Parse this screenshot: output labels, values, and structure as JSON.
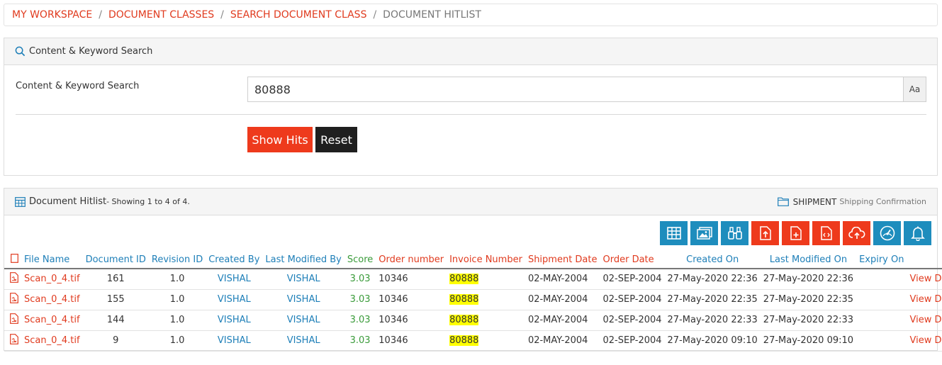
{
  "breadcrumb": {
    "items": [
      "MY WORKSPACE",
      "DOCUMENT CLASSES",
      "SEARCH DOCUMENT CLASS",
      "DOCUMENT HITLIST"
    ],
    "separator": "/"
  },
  "search": {
    "panel_title": "Content & Keyword Search",
    "field_label": "Content & Keyword Search",
    "value": "80888",
    "case_button": "Aa",
    "show_hits_label": "Show Hits",
    "reset_label": "Reset"
  },
  "hitlist": {
    "title": "Document Hitlist",
    "showing": " - Showing 1 to 4 of 4.",
    "doc_type": "SHIPMENT",
    "doc_sub": "Shipping Confirmation",
    "toolbar_icons": [
      {
        "name": "table-view-icon",
        "color": "blue"
      },
      {
        "name": "image-view-icon",
        "color": "blue"
      },
      {
        "name": "binoculars-icon",
        "color": "blue"
      },
      {
        "name": "file-upload-icon",
        "color": "red"
      },
      {
        "name": "file-add-icon",
        "color": "red"
      },
      {
        "name": "file-code-icon",
        "color": "red"
      },
      {
        "name": "cloud-upload-icon",
        "color": "red"
      },
      {
        "name": "dashboard-icon",
        "color": "blue"
      },
      {
        "name": "bell-icon",
        "color": "blue"
      }
    ],
    "columns": [
      "File Name",
      "Document ID",
      "Revision ID",
      "Created By",
      "Last Modified By",
      "Score",
      "Order number",
      "Invoice Number",
      "Shipment Date",
      "Order Date",
      "Created On",
      "Last Modified On",
      "Expiry On"
    ],
    "rows": [
      {
        "file": "Scan_0_4.tif",
        "doc_id": "161",
        "rev": "1.0",
        "created_by": "VISHAL",
        "modified_by": "VISHAL",
        "score": "3.03",
        "order_no": "10346",
        "invoice": "80888",
        "ship_date": "02-MAY-2004",
        "order_date": "02-SEP-2004",
        "created_on": "27-May-2020 22:36",
        "modified_on": "27-May-2020 22:36",
        "expiry": "",
        "action": "View Document"
      },
      {
        "file": "Scan_0_4.tif",
        "doc_id": "155",
        "rev": "1.0",
        "created_by": "VISHAL",
        "modified_by": "VISHAL",
        "score": "3.03",
        "order_no": "10346",
        "invoice": "80888",
        "ship_date": "02-MAY-2004",
        "order_date": "02-SEP-2004",
        "created_on": "27-May-2020 22:35",
        "modified_on": "27-May-2020 22:35",
        "expiry": "",
        "action": "View Document"
      },
      {
        "file": "Scan_0_4.tif",
        "doc_id": "144",
        "rev": "1.0",
        "created_by": "VISHAL",
        "modified_by": "VISHAL",
        "score": "3.03",
        "order_no": "10346",
        "invoice": "80888",
        "ship_date": "02-MAY-2004",
        "order_date": "02-SEP-2004",
        "created_on": "27-May-2020 22:33",
        "modified_on": "27-May-2020 22:33",
        "expiry": "",
        "action": "View Document"
      },
      {
        "file": "Scan_0_4.tif",
        "doc_id": "9",
        "rev": "1.0",
        "created_by": "VISHAL",
        "modified_by": "VISHAL",
        "score": "3.03",
        "order_no": "10346",
        "invoice": "80888",
        "ship_date": "02-MAY-2004",
        "order_date": "02-SEP-2004",
        "created_on": "27-May-2020 09:10",
        "modified_on": "27-May-2020 09:10",
        "expiry": "",
        "action": "View Document"
      }
    ]
  },
  "colors": {
    "accent_red": "#ee3a1c",
    "link_red": "#e03a1e",
    "link_blue": "#1e7fb8",
    "score_green": "#3a9b3a",
    "toolbar_blue": "#1e8dbd",
    "highlight": "#ffff00"
  }
}
